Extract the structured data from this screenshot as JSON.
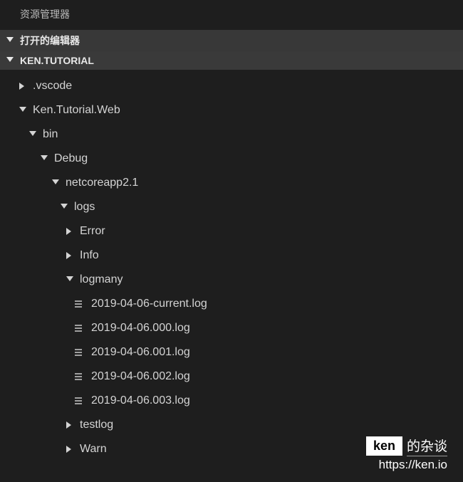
{
  "explorer": {
    "title": "资源管理器",
    "sections": {
      "openEditors": "打开的编辑器",
      "workspace": "KEN.TUTORIAL"
    }
  },
  "tree": [
    {
      "label": ".vscode",
      "type": "folder",
      "state": "collapsed",
      "indent": 0
    },
    {
      "label": "Ken.Tutorial.Web",
      "type": "folder",
      "state": "expanded",
      "indent": 0
    },
    {
      "label": "bin",
      "type": "folder",
      "state": "expanded",
      "indent": 1
    },
    {
      "label": "Debug",
      "type": "folder",
      "state": "expanded",
      "indent": 2
    },
    {
      "label": "netcoreapp2.1",
      "type": "folder",
      "state": "expanded",
      "indent": 3
    },
    {
      "label": "logs",
      "type": "folder",
      "state": "expanded",
      "indent": 4
    },
    {
      "label": "Error",
      "type": "folder",
      "state": "collapsed",
      "indent": 5
    },
    {
      "label": "Info",
      "type": "folder",
      "state": "collapsed",
      "indent": 5
    },
    {
      "label": "logmany",
      "type": "folder",
      "state": "expanded",
      "indent": 5
    },
    {
      "label": "2019-04-06-current.log",
      "type": "file",
      "indent": 6
    },
    {
      "label": "2019-04-06.000.log",
      "type": "file",
      "indent": 6
    },
    {
      "label": "2019-04-06.001.log",
      "type": "file",
      "indent": 6
    },
    {
      "label": "2019-04-06.002.log",
      "type": "file",
      "indent": 6
    },
    {
      "label": "2019-04-06.003.log",
      "type": "file",
      "indent": 6
    },
    {
      "label": "testlog",
      "type": "folder",
      "state": "collapsed",
      "indent": 5
    },
    {
      "label": "Warn",
      "type": "folder",
      "state": "collapsed",
      "indent": 5
    }
  ],
  "watermark": {
    "badge": "ken",
    "text": "的杂谈",
    "url": "https://ken.io"
  }
}
